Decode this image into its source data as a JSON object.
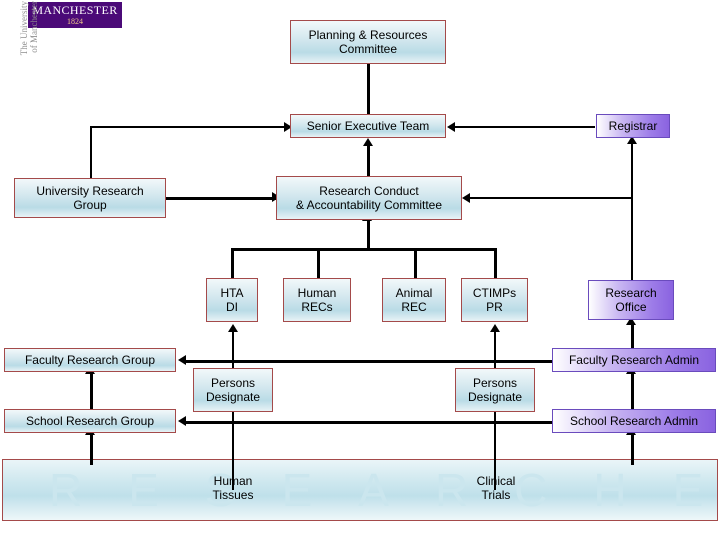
{
  "logo": {
    "banner_word": "MANCHESTER",
    "banner_year": "1824",
    "vertical_line1": "The University",
    "vertical_line2": "of Manchester"
  },
  "colors": {
    "logo_purple": "#4b0a78",
    "box_border_maroon": "#a44a4a",
    "box_border_purple": "#6a4bbd",
    "band_text": "#cbe6ee",
    "connector": "#000000"
  },
  "nodes": {
    "planning_resources": {
      "line1": "Planning  & Resources",
      "line2": "Committee",
      "style": "blue"
    },
    "senior_executive": {
      "line1": "Senior Executive Team",
      "style": "blue"
    },
    "registrar": {
      "line1": "Registrar",
      "style": "purple"
    },
    "university_research_group": {
      "line1": "University Research",
      "line2": "Group",
      "style": "blue"
    },
    "research_conduct": {
      "line1": "Research Conduct",
      "line2": "& Accountability Committee",
      "style": "blue"
    },
    "hta_di": {
      "line1": "HTA",
      "line2": "DI",
      "style": "blue"
    },
    "human_recs": {
      "line1": "Human",
      "line2": "RECs",
      "style": "blue"
    },
    "animal_rec": {
      "line1": "Animal",
      "line2": "REC",
      "style": "blue"
    },
    "ctimps_pr": {
      "line1": "CTIMPs",
      "line2": "PR",
      "style": "blue"
    },
    "research_office": {
      "line1": "Research",
      "line2": "Office",
      "style": "purple"
    },
    "faculty_research_group": {
      "line1": "Faculty Research Group",
      "style": "blue"
    },
    "school_research_group": {
      "line1": "School Research Group",
      "style": "blue"
    },
    "faculty_research_admin": {
      "line1": "Faculty Research Admin",
      "style": "purple"
    },
    "school_research_admin": {
      "line1": "School Research Admin",
      "style": "purple"
    },
    "persons_designate_left": {
      "line1": "Persons",
      "line2": "Designate",
      "style": "blue"
    },
    "persons_designate_right": {
      "line1": "Persons",
      "line2": "Designate",
      "style": "blue"
    }
  },
  "band": {
    "background_text": "RESEARCHERS",
    "label_human_tissues_line1": "Human",
    "label_human_tissues_line2": "Tissues",
    "label_clinical_trials_line1": "Clinical",
    "label_clinical_trials_line2": "Trials"
  }
}
